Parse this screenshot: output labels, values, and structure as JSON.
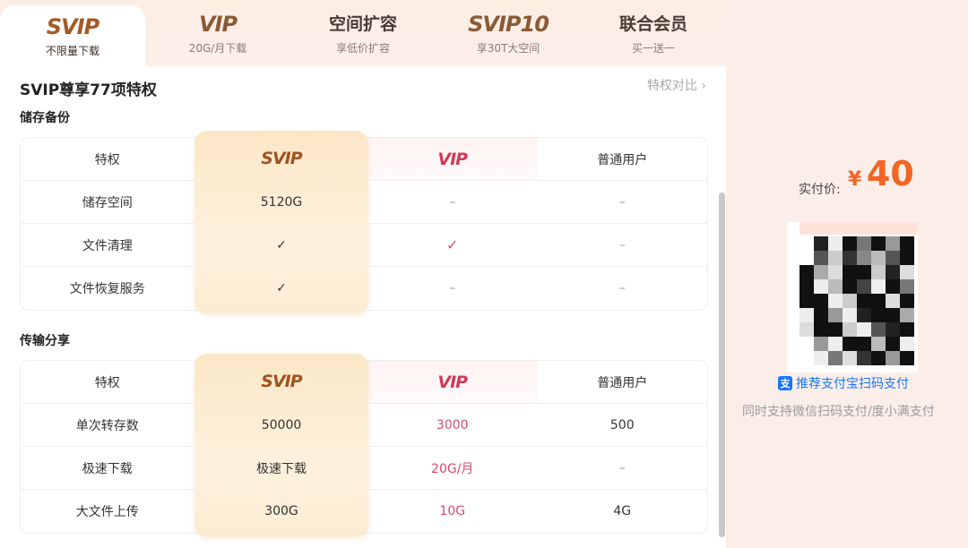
{
  "tabs": [
    {
      "logo": "SVIP",
      "subtitle": "不限量下载",
      "active": true
    },
    {
      "logo": "VIP",
      "subtitle": "20G/月下载",
      "active": false
    },
    {
      "title": "空间扩容",
      "subtitle": "享低价扩容",
      "active": false
    },
    {
      "logo": "SVIP10",
      "subtitle": "享30T大空间",
      "active": false
    },
    {
      "title": "联合会员",
      "subtitle": "买一送一",
      "active": false
    }
  ],
  "heading": "SVIP尊享77项特权",
  "compare_link": "特权对比 ›",
  "sections": [
    {
      "title": "储存备份",
      "header": {
        "col0": "特权",
        "col1": "SVIP",
        "col2": "VIP",
        "col3": "普通用户"
      },
      "rows": [
        {
          "name": "储存空间",
          "svip": "5120G",
          "vip": "–",
          "normal": "–"
        },
        {
          "name": "文件清理",
          "svip": "✓",
          "vip": "✓",
          "normal": "–"
        },
        {
          "name": "文件恢复服务",
          "svip": "✓",
          "vip": "–",
          "normal": "–"
        }
      ]
    },
    {
      "title": "传输分享",
      "header": {
        "col0": "特权",
        "col1": "SVIP",
        "col2": "VIP",
        "col3": "普通用户"
      },
      "rows": [
        {
          "name": "单次转存数",
          "svip": "50000",
          "vip": "3000",
          "normal": "500"
        },
        {
          "name": "极速下载",
          "svip": "极速下载",
          "vip": "20G/月",
          "normal": "–"
        },
        {
          "name": "大文件上传",
          "svip": "300G",
          "vip": "10G",
          "normal": "4G"
        }
      ]
    }
  ],
  "payment": {
    "price_label": "实付价:",
    "currency": "¥",
    "price": "40",
    "alipay_icon": "支",
    "alipay_text": "推荐支付宝扫码支付",
    "note": "同时支持微信扫码支付/度小满支付"
  },
  "colors": {
    "accent": "#f26522",
    "vip": "#d54b6f",
    "svip": "#a0521e",
    "alipay": "#1677ff"
  }
}
